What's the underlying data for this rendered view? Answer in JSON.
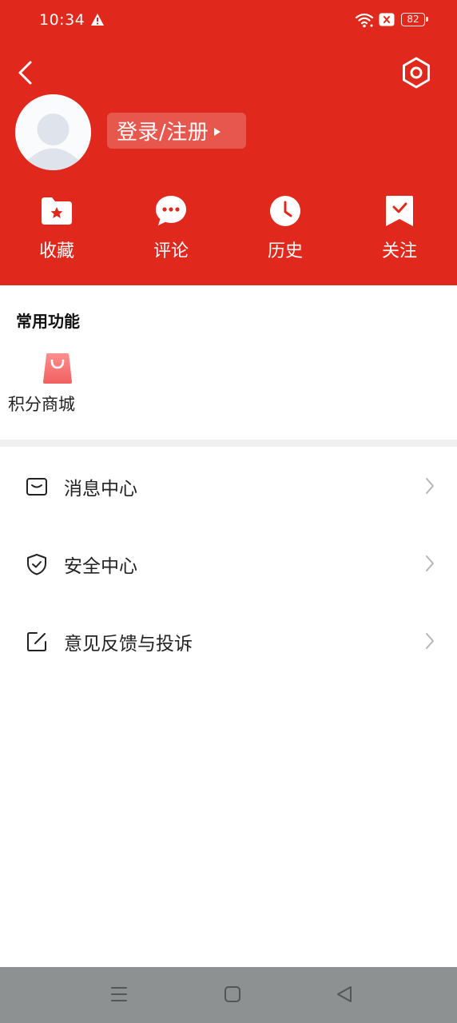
{
  "status_bar": {
    "time": "10:34",
    "battery": "82",
    "icons": [
      "warning-icon",
      "wifi-icon",
      "sim-blocked-icon",
      "battery-icon"
    ]
  },
  "header": {
    "back_icon": "chevron-left-icon",
    "settings_icon": "hexagon-gear-icon",
    "avatar_icon": "default-avatar",
    "login_label": "登录/注册",
    "background_color": "#e0281c"
  },
  "quick_actions": [
    {
      "label": "收藏",
      "icon": "folder-star-icon"
    },
    {
      "label": "评论",
      "icon": "chat-bubble-icon"
    },
    {
      "label": "历史",
      "icon": "clock-icon"
    },
    {
      "label": "关注",
      "icon": "bookmark-check-icon"
    }
  ],
  "common_functions": {
    "title": "常用功能",
    "items": [
      {
        "label": "积分商城",
        "icon": "shopping-bag-icon"
      }
    ]
  },
  "menu": [
    {
      "label": "消息中心",
      "icon": "message-envelope-icon"
    },
    {
      "label": "安全中心",
      "icon": "shield-check-icon"
    },
    {
      "label": "意见反馈与投诉",
      "icon": "edit-square-icon"
    }
  ],
  "nav_bar": {
    "buttons": [
      "menu-icon",
      "home-square-icon",
      "back-triangle-icon"
    ]
  }
}
